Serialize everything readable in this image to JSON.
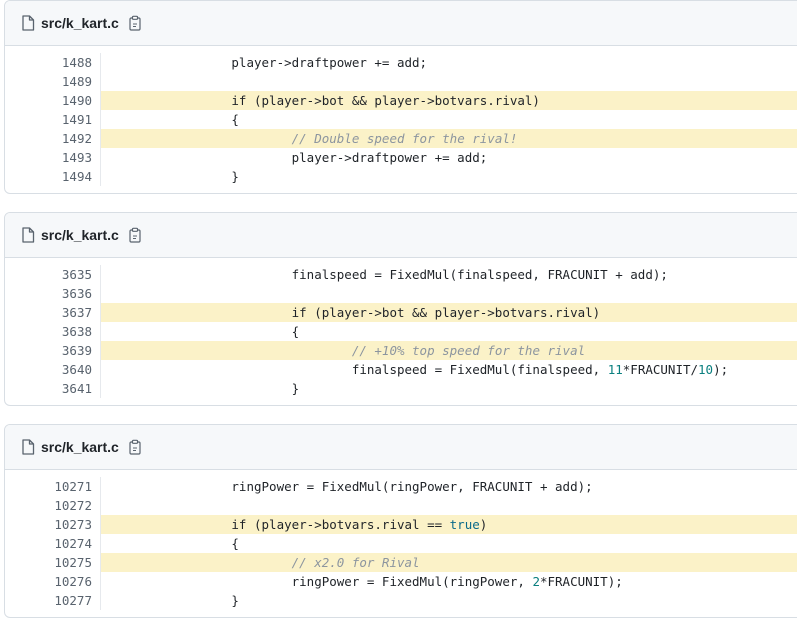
{
  "blocks": [
    {
      "file": "src/k_kart.c",
      "lines": [
        {
          "num": "1488",
          "hl": false,
          "tokens": [
            {
              "t": "plain",
              "v": "                player->draftpower += add;"
            }
          ]
        },
        {
          "num": "1489",
          "hl": false,
          "tokens": [
            {
              "t": "plain",
              "v": ""
            }
          ]
        },
        {
          "num": "1490",
          "hl": true,
          "tokens": [
            {
              "t": "plain",
              "v": "                if (player->bot && player->botvars.rival)"
            }
          ]
        },
        {
          "num": "1491",
          "hl": false,
          "tokens": [
            {
              "t": "plain",
              "v": "                {"
            }
          ]
        },
        {
          "num": "1492",
          "hl": true,
          "tokens": [
            {
              "t": "plain",
              "v": "                        "
            },
            {
              "t": "comment",
              "v": "// Double speed for the rival!"
            }
          ]
        },
        {
          "num": "1493",
          "hl": false,
          "tokens": [
            {
              "t": "plain",
              "v": "                        player->draftpower += add;"
            }
          ]
        },
        {
          "num": "1494",
          "hl": false,
          "tokens": [
            {
              "t": "plain",
              "v": "                }"
            }
          ]
        }
      ]
    },
    {
      "file": "src/k_kart.c",
      "lines": [
        {
          "num": "3635",
          "hl": false,
          "tokens": [
            {
              "t": "plain",
              "v": "                        finalspeed = FixedMul(finalspeed, FRACUNIT + add);"
            }
          ]
        },
        {
          "num": "3636",
          "hl": false,
          "tokens": [
            {
              "t": "plain",
              "v": ""
            }
          ]
        },
        {
          "num": "3637",
          "hl": true,
          "tokens": [
            {
              "t": "plain",
              "v": "                        if (player->bot && player->botvars.rival)"
            }
          ]
        },
        {
          "num": "3638",
          "hl": false,
          "tokens": [
            {
              "t": "plain",
              "v": "                        {"
            }
          ]
        },
        {
          "num": "3639",
          "hl": true,
          "tokens": [
            {
              "t": "plain",
              "v": "                                "
            },
            {
              "t": "comment",
              "v": "// +10% top speed for the rival"
            }
          ]
        },
        {
          "num": "3640",
          "hl": false,
          "tokens": [
            {
              "t": "plain",
              "v": "                                finalspeed = FixedMul(finalspeed, "
            },
            {
              "t": "number",
              "v": "11"
            },
            {
              "t": "plain",
              "v": "*FRACUNIT/"
            },
            {
              "t": "number",
              "v": "10"
            },
            {
              "t": "plain",
              "v": ");"
            }
          ]
        },
        {
          "num": "3641",
          "hl": false,
          "tokens": [
            {
              "t": "plain",
              "v": "                        }"
            }
          ]
        }
      ]
    },
    {
      "file": "src/k_kart.c",
      "lines": [
        {
          "num": "10271",
          "hl": false,
          "tokens": [
            {
              "t": "plain",
              "v": "                ringPower = FixedMul(ringPower, FRACUNIT + add);"
            }
          ]
        },
        {
          "num": "10272",
          "hl": false,
          "tokens": [
            {
              "t": "plain",
              "v": ""
            }
          ]
        },
        {
          "num": "10273",
          "hl": true,
          "tokens": [
            {
              "t": "plain",
              "v": "                if (player->botvars.rival == "
            },
            {
              "t": "bool",
              "v": "true"
            },
            {
              "t": "plain",
              "v": ")"
            }
          ]
        },
        {
          "num": "10274",
          "hl": false,
          "tokens": [
            {
              "t": "plain",
              "v": "                {"
            }
          ]
        },
        {
          "num": "10275",
          "hl": true,
          "tokens": [
            {
              "t": "plain",
              "v": "                        "
            },
            {
              "t": "comment",
              "v": "// x2.0 for Rival"
            }
          ]
        },
        {
          "num": "10276",
          "hl": false,
          "tokens": [
            {
              "t": "plain",
              "v": "                        ringPower = FixedMul(ringPower, "
            },
            {
              "t": "number",
              "v": "2"
            },
            {
              "t": "plain",
              "v": "*FRACUNIT);"
            }
          ]
        },
        {
          "num": "10277",
          "hl": false,
          "tokens": [
            {
              "t": "plain",
              "v": "                }"
            }
          ]
        }
      ]
    }
  ],
  "icons": {
    "file": "file-icon",
    "copy": "copy-icon"
  }
}
